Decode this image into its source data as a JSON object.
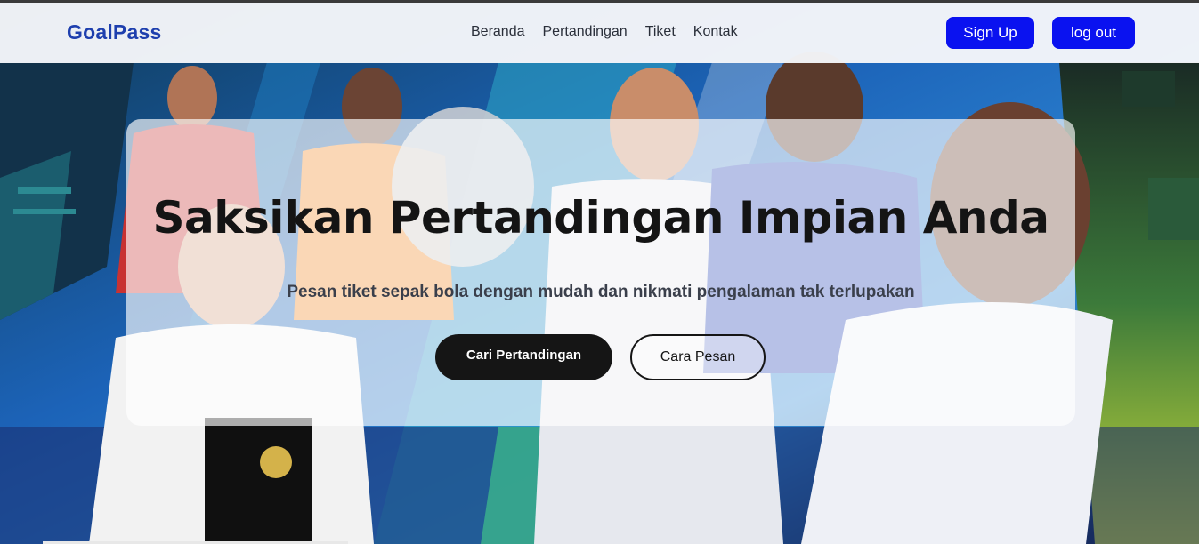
{
  "navbar": {
    "brand": "GoalPass",
    "links": [
      {
        "label": "Beranda"
      },
      {
        "label": "Pertandingan"
      },
      {
        "label": "Tiket"
      },
      {
        "label": "Kontak"
      }
    ],
    "signup_label": "Sign Up",
    "logout_label": "log out"
  },
  "hero": {
    "title": "Saksikan Pertandingan Impian Anda",
    "subtitle": "Pesan tiket sepak bola dengan mudah dan nikmati pengalaman tak terlupakan",
    "primary_button_label": "Cari Pertandingan",
    "secondary_button_label": "Cara Pesan"
  },
  "colors": {
    "brand": "#1e3fae",
    "nav_button": "#0a12f0",
    "primary_button": "#151515"
  }
}
